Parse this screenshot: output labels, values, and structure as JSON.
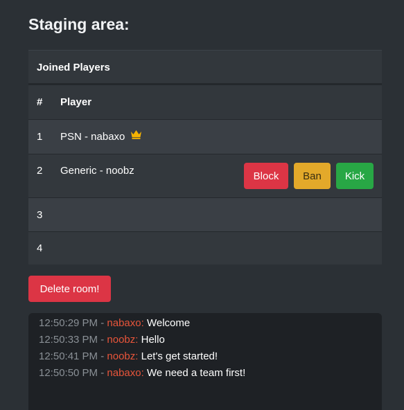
{
  "title": "Staging area:",
  "table": {
    "caption": "Joined Players",
    "headers": {
      "num": "#",
      "player": "Player"
    },
    "rows": [
      {
        "num": "1",
        "player": "PSN - nabaxo",
        "host_icon": "crown-icon"
      },
      {
        "num": "2",
        "player": "Generic - noobz",
        "actions": {
          "block": "Block",
          "ban": "Ban",
          "kick": "Kick"
        }
      },
      {
        "num": "3",
        "player": ""
      },
      {
        "num": "4",
        "player": ""
      }
    ]
  },
  "delete_button": "Delete room!",
  "chat": {
    "separator": "-",
    "messages": [
      {
        "time": "12:50:29 PM",
        "user": "nabaxo:",
        "text": "Welcome"
      },
      {
        "time": "12:50:33 PM",
        "user": "noobz:",
        "text": "Hello"
      },
      {
        "time": "12:50:41 PM",
        "user": "noobz:",
        "text": "Let's get started!"
      },
      {
        "time": "12:50:50 PM",
        "user": "nabaxo:",
        "text": "We need a team first!"
      }
    ]
  },
  "colors": {
    "background": "#2b3035",
    "danger": "#dc3545",
    "warning": "#e3a92a",
    "success": "#28a745",
    "chat_username": "#e8553a",
    "crown": "#f5b301"
  }
}
